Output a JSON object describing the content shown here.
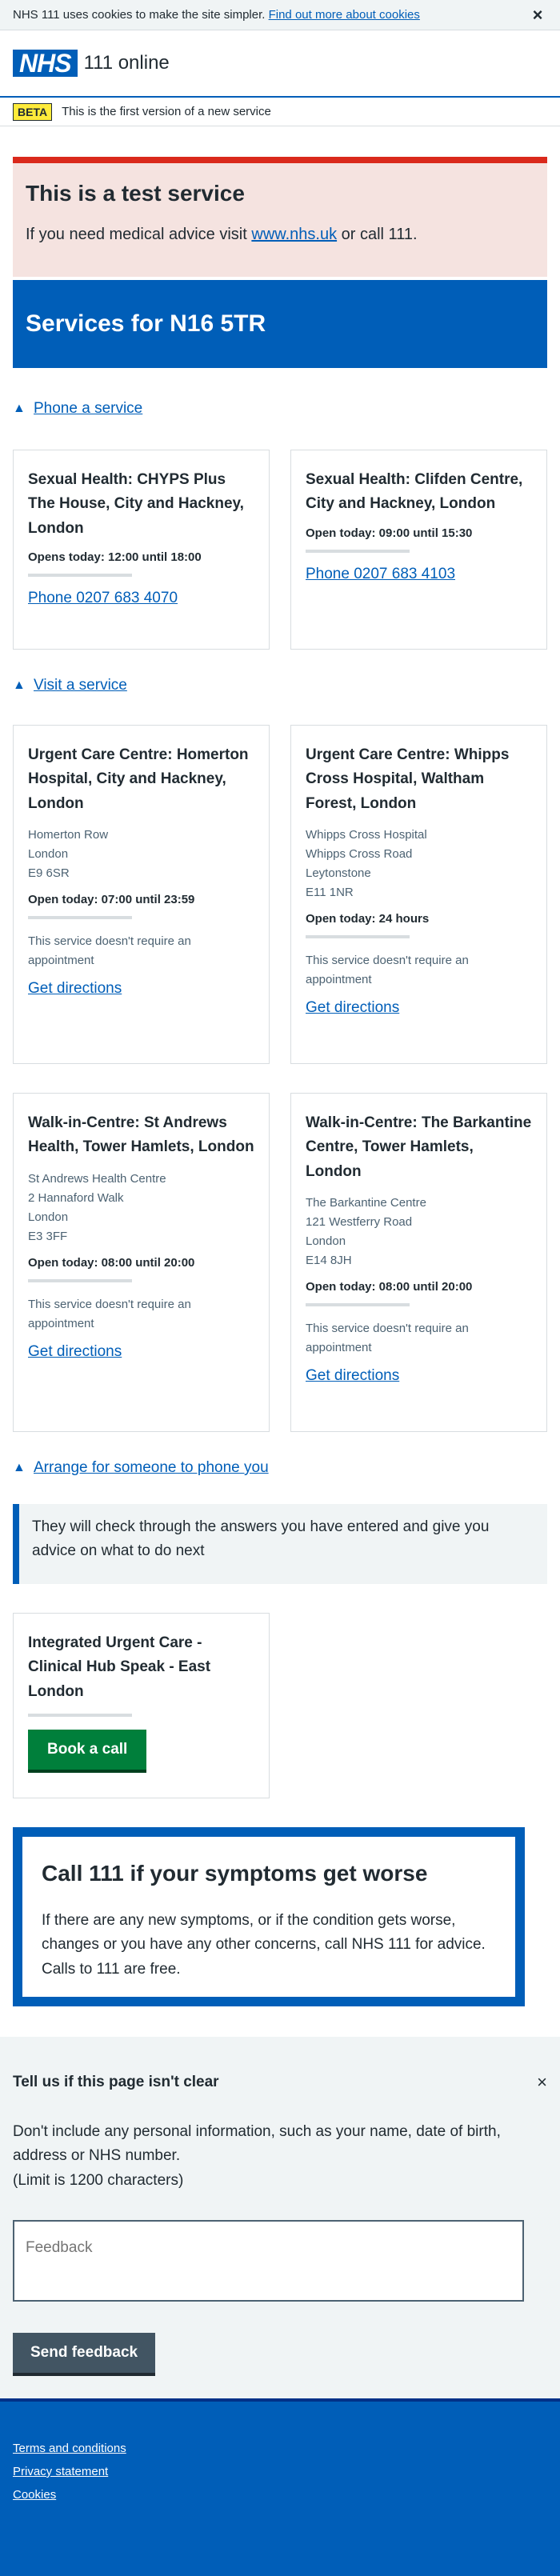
{
  "cookie_banner": {
    "text": "NHS 111 uses cookies to make the site simpler.",
    "link": "Find out more about cookies",
    "close_icon": "close-icon"
  },
  "header": {
    "logo": "NHS",
    "service_name": "111 online"
  },
  "beta": {
    "tag": "BETA",
    "text": "This is the first version of a new service"
  },
  "test_alert": {
    "title": "This is a test service",
    "text_before": "If you need medical advice visit ",
    "link": "www.nhs.uk",
    "text_after": " or call 111."
  },
  "services_title": "Services for N16 5TR",
  "phone_section": {
    "toggle": "Phone a service",
    "cards": [
      {
        "title": "Sexual Health: CHYPS Plus The House, City and Hackney, London",
        "opens": "Opens today: 12:00 until 18:00",
        "phone": "Phone 0207 683 4070"
      },
      {
        "title": "Sexual Health: Clifden Centre, City and Hackney, London",
        "opens": "Open today: 09:00 until 15:30",
        "phone": "Phone 0207 683 4103"
      }
    ]
  },
  "visit_section": {
    "toggle": "Visit a service",
    "cards": [
      {
        "title": "Urgent Care Centre: Homerton Hospital, City and Hackney, London",
        "address": [
          "Homerton Row",
          "London",
          "E9 6SR"
        ],
        "opens": "Open today: 07:00 until 23:59",
        "note": "This service doesn't require an appointment",
        "link": "Get directions"
      },
      {
        "title": "Urgent Care Centre: Whipps Cross Hospital, Waltham Forest, London",
        "address": [
          "Whipps Cross Hospital",
          "Whipps Cross Road",
          "Leytonstone",
          "E11 1NR"
        ],
        "opens": "Open today: 24 hours",
        "note": "This service doesn't require an appointment",
        "link": "Get directions"
      },
      {
        "title": "Walk-in-Centre: St Andrews Health, Tower Hamlets, London",
        "address": [
          "St Andrews Health Centre",
          "2 Hannaford Walk",
          "London",
          "E3 3FF"
        ],
        "opens": "Open today: 08:00 until 20:00",
        "note": "This service doesn't require an appointment",
        "link": "Get directions"
      },
      {
        "title": "Walk-in-Centre: The Barkantine Centre, Tower Hamlets, London",
        "address": [
          "The Barkantine Centre",
          "121 Westferry Road",
          "London",
          "E14 8JH"
        ],
        "opens": "Open today: 08:00 until 20:00",
        "note": "This service doesn't require an appointment",
        "link": "Get directions"
      }
    ]
  },
  "callback_section": {
    "toggle": "Arrange for someone to phone you",
    "inset": "They will check through the answers you have entered and give you advice on what to do next",
    "card_title": "Integrated Urgent Care - Clinical Hub Speak - East London",
    "button": "Book a call"
  },
  "care_card": {
    "title": "Call 111 if your symptoms get worse",
    "text": "If there are any new symptoms, or if the condition gets worse, changes or you have any other concerns, call NHS 111 for advice. Calls to 111 are free."
  },
  "feedback": {
    "title": "Tell us if this page isn't clear",
    "text": "Don't include any personal information, such as your name, date of birth, address or NHS number.",
    "limit": "(Limit is 1200 characters)",
    "placeholder": "Feedback",
    "button": "Send feedback"
  },
  "footer": {
    "links": [
      "Terms and conditions",
      "Privacy statement",
      "Cookies"
    ]
  },
  "colors": {
    "nhs_blue": "#005eb8",
    "green": "#007f3b",
    "red": "#da291c",
    "yellow": "#ffeb3b"
  }
}
